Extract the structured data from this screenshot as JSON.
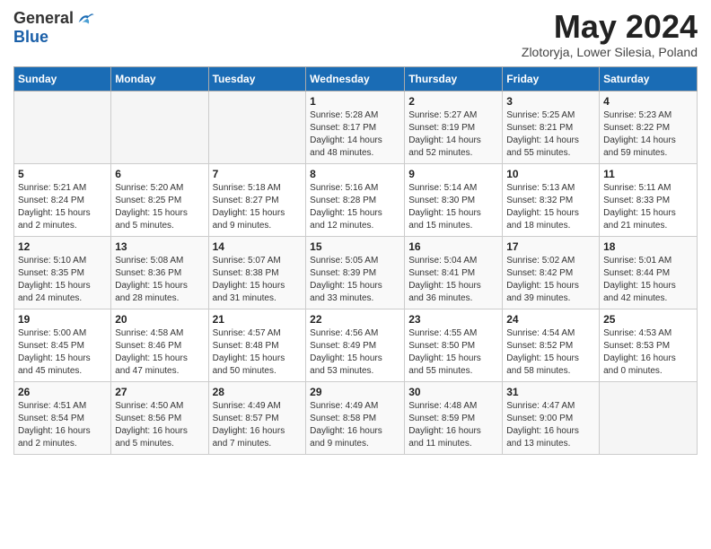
{
  "header": {
    "logo_general": "General",
    "logo_blue": "Blue",
    "month_year": "May 2024",
    "location": "Zlotoryja, Lower Silesia, Poland"
  },
  "weekdays": [
    "Sunday",
    "Monday",
    "Tuesday",
    "Wednesday",
    "Thursday",
    "Friday",
    "Saturday"
  ],
  "weeks": [
    [
      {
        "day": "",
        "info": ""
      },
      {
        "day": "",
        "info": ""
      },
      {
        "day": "",
        "info": ""
      },
      {
        "day": "1",
        "info": "Sunrise: 5:28 AM\nSunset: 8:17 PM\nDaylight: 14 hours\nand 48 minutes."
      },
      {
        "day": "2",
        "info": "Sunrise: 5:27 AM\nSunset: 8:19 PM\nDaylight: 14 hours\nand 52 minutes."
      },
      {
        "day": "3",
        "info": "Sunrise: 5:25 AM\nSunset: 8:21 PM\nDaylight: 14 hours\nand 55 minutes."
      },
      {
        "day": "4",
        "info": "Sunrise: 5:23 AM\nSunset: 8:22 PM\nDaylight: 14 hours\nand 59 minutes."
      }
    ],
    [
      {
        "day": "5",
        "info": "Sunrise: 5:21 AM\nSunset: 8:24 PM\nDaylight: 15 hours\nand 2 minutes."
      },
      {
        "day": "6",
        "info": "Sunrise: 5:20 AM\nSunset: 8:25 PM\nDaylight: 15 hours\nand 5 minutes."
      },
      {
        "day": "7",
        "info": "Sunrise: 5:18 AM\nSunset: 8:27 PM\nDaylight: 15 hours\nand 9 minutes."
      },
      {
        "day": "8",
        "info": "Sunrise: 5:16 AM\nSunset: 8:28 PM\nDaylight: 15 hours\nand 12 minutes."
      },
      {
        "day": "9",
        "info": "Sunrise: 5:14 AM\nSunset: 8:30 PM\nDaylight: 15 hours\nand 15 minutes."
      },
      {
        "day": "10",
        "info": "Sunrise: 5:13 AM\nSunset: 8:32 PM\nDaylight: 15 hours\nand 18 minutes."
      },
      {
        "day": "11",
        "info": "Sunrise: 5:11 AM\nSunset: 8:33 PM\nDaylight: 15 hours\nand 21 minutes."
      }
    ],
    [
      {
        "day": "12",
        "info": "Sunrise: 5:10 AM\nSunset: 8:35 PM\nDaylight: 15 hours\nand 24 minutes."
      },
      {
        "day": "13",
        "info": "Sunrise: 5:08 AM\nSunset: 8:36 PM\nDaylight: 15 hours\nand 28 minutes."
      },
      {
        "day": "14",
        "info": "Sunrise: 5:07 AM\nSunset: 8:38 PM\nDaylight: 15 hours\nand 31 minutes."
      },
      {
        "day": "15",
        "info": "Sunrise: 5:05 AM\nSunset: 8:39 PM\nDaylight: 15 hours\nand 33 minutes."
      },
      {
        "day": "16",
        "info": "Sunrise: 5:04 AM\nSunset: 8:41 PM\nDaylight: 15 hours\nand 36 minutes."
      },
      {
        "day": "17",
        "info": "Sunrise: 5:02 AM\nSunset: 8:42 PM\nDaylight: 15 hours\nand 39 minutes."
      },
      {
        "day": "18",
        "info": "Sunrise: 5:01 AM\nSunset: 8:44 PM\nDaylight: 15 hours\nand 42 minutes."
      }
    ],
    [
      {
        "day": "19",
        "info": "Sunrise: 5:00 AM\nSunset: 8:45 PM\nDaylight: 15 hours\nand 45 minutes."
      },
      {
        "day": "20",
        "info": "Sunrise: 4:58 AM\nSunset: 8:46 PM\nDaylight: 15 hours\nand 47 minutes."
      },
      {
        "day": "21",
        "info": "Sunrise: 4:57 AM\nSunset: 8:48 PM\nDaylight: 15 hours\nand 50 minutes."
      },
      {
        "day": "22",
        "info": "Sunrise: 4:56 AM\nSunset: 8:49 PM\nDaylight: 15 hours\nand 53 minutes."
      },
      {
        "day": "23",
        "info": "Sunrise: 4:55 AM\nSunset: 8:50 PM\nDaylight: 15 hours\nand 55 minutes."
      },
      {
        "day": "24",
        "info": "Sunrise: 4:54 AM\nSunset: 8:52 PM\nDaylight: 15 hours\nand 58 minutes."
      },
      {
        "day": "25",
        "info": "Sunrise: 4:53 AM\nSunset: 8:53 PM\nDaylight: 16 hours\nand 0 minutes."
      }
    ],
    [
      {
        "day": "26",
        "info": "Sunrise: 4:51 AM\nSunset: 8:54 PM\nDaylight: 16 hours\nand 2 minutes."
      },
      {
        "day": "27",
        "info": "Sunrise: 4:50 AM\nSunset: 8:56 PM\nDaylight: 16 hours\nand 5 minutes."
      },
      {
        "day": "28",
        "info": "Sunrise: 4:49 AM\nSunset: 8:57 PM\nDaylight: 16 hours\nand 7 minutes."
      },
      {
        "day": "29",
        "info": "Sunrise: 4:49 AM\nSunset: 8:58 PM\nDaylight: 16 hours\nand 9 minutes."
      },
      {
        "day": "30",
        "info": "Sunrise: 4:48 AM\nSunset: 8:59 PM\nDaylight: 16 hours\nand 11 minutes."
      },
      {
        "day": "31",
        "info": "Sunrise: 4:47 AM\nSunset: 9:00 PM\nDaylight: 16 hours\nand 13 minutes."
      },
      {
        "day": "",
        "info": ""
      }
    ]
  ]
}
